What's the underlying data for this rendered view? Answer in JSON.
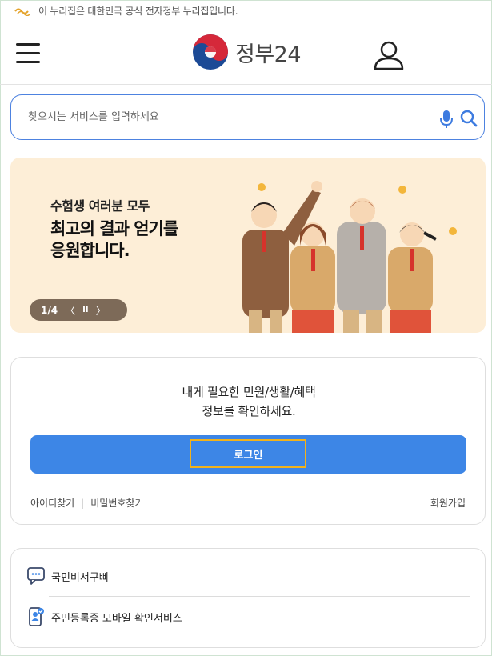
{
  "notice": {
    "text": "이 누리집은 대한민국 공식 전자정부 누리집입니다."
  },
  "header": {
    "logo_text": "정부24"
  },
  "search": {
    "placeholder": "찾으시는 서비스를 입력하세요"
  },
  "banner": {
    "line1": "수험생 여러분 모두",
    "line2": "최고의 결과 얻기를",
    "line3": "응원합니다.",
    "pager": {
      "count": "1/4",
      "prev": "〈",
      "pause": "II",
      "next": "〉"
    }
  },
  "login": {
    "message_line1": "내게 필요한 민원/생활/혜택",
    "message_line2": "정보를 확인하세요.",
    "button_label": "로그인",
    "find_id": "아이디찾기",
    "find_password": "비밀번호찾기",
    "signup": "회원가입"
  },
  "services": [
    {
      "label": "국민비서구삐",
      "icon": "chat-bubble-icon"
    },
    {
      "label": "주민등록증 모바일 확인서비스",
      "icon": "mobile-id-icon"
    }
  ],
  "colors": {
    "accent": "#3d86e6",
    "search_border": "#4d82e0",
    "banner_bg": "#fdeed7",
    "focus_outline": "#f2b21a"
  }
}
